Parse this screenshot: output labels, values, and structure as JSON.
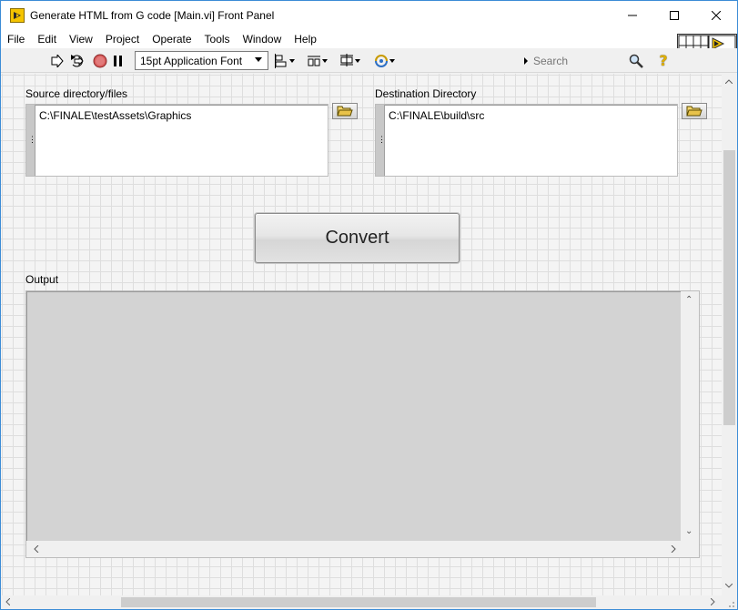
{
  "window": {
    "title": "Generate HTML from G code [Main.vi] Front Panel"
  },
  "menu": [
    "File",
    "Edit",
    "View",
    "Project",
    "Operate",
    "Tools",
    "Window",
    "Help"
  ],
  "toolbar": {
    "font": "15pt Application Font",
    "search_placeholder": "Search",
    "help_glyph": "?"
  },
  "panel": {
    "source_label": "Source directory/files",
    "source_path": "C:\\FINALE\\testAssets\\Graphics",
    "dest_label": "Destination Directory",
    "dest_path": "C:\\FINALE\\build\\src",
    "convert_label": "Convert",
    "output_label": "Output",
    "output_text": ""
  },
  "colors": {
    "window_border": "#3c8cd6",
    "panel_bg": "#f4f4f4",
    "output_bg": "#d3d3d3"
  }
}
